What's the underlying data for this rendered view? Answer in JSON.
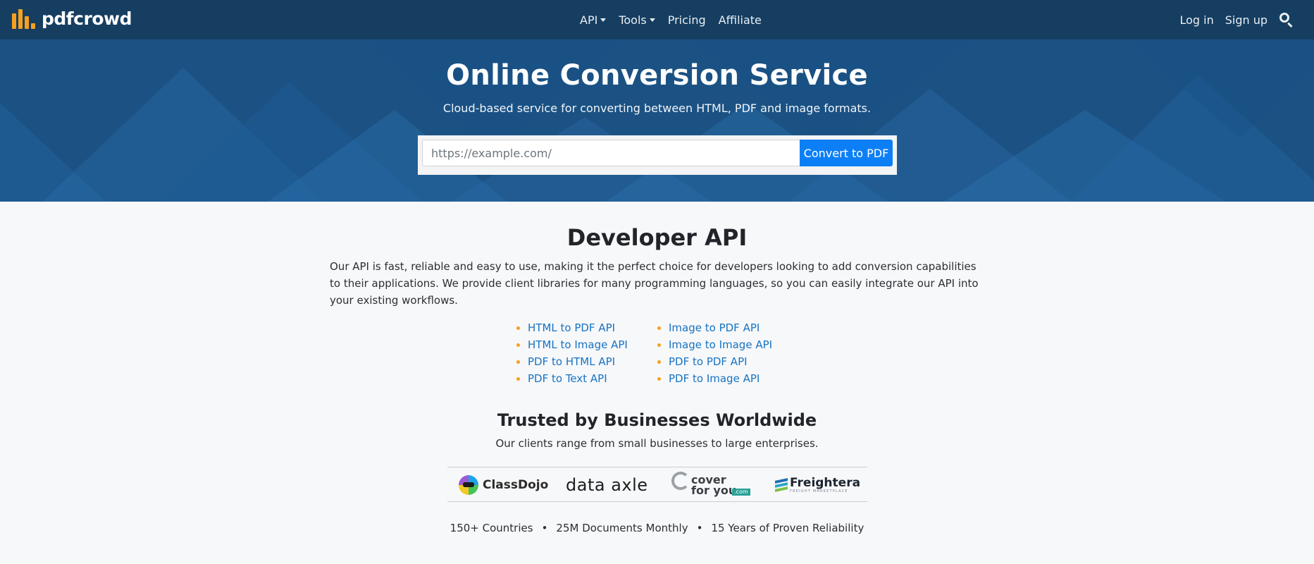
{
  "brand": {
    "name": "pdfcrowd",
    "accent": "#f7a01d"
  },
  "nav": {
    "items": [
      {
        "label": "API",
        "dropdown": true
      },
      {
        "label": "Tools",
        "dropdown": true
      },
      {
        "label": "Pricing",
        "dropdown": false
      },
      {
        "label": "Affiliate",
        "dropdown": false
      }
    ],
    "login": "Log in",
    "signup": "Sign up",
    "search_icon": "search-icon"
  },
  "hero": {
    "title": "Online Conversion Service",
    "subtitle": "Cloud-based service for converting between HTML, PDF and image formats.",
    "url_placeholder": "https://example.com/",
    "url_value": "",
    "convert_label": "Convert to PDF",
    "bg_color": "#1b5283",
    "button_color": "#0d7ff6"
  },
  "developer": {
    "title": "Developer API",
    "description": "Our API is fast, reliable and easy to use, making it the perfect choice for developers looking to add conversion capabilities to their applications. We provide client libraries for many programming languages, so you can easily integrate our API into your existing workflows.",
    "apis_col1": [
      "HTML to PDF API",
      "HTML to Image API",
      "PDF to HTML API",
      "PDF to Text API"
    ],
    "apis_col2": [
      "Image to PDF API",
      "Image to Image API",
      "PDF to PDF API",
      "PDF to Image API"
    ]
  },
  "trusted": {
    "title": "Trusted by Businesses Worldwide",
    "subtitle": "Our clients range from small businesses to large enterprises.",
    "logos": {
      "classdojo": "ClassDojo",
      "dataaxle": "data axle",
      "cover_line1": "cover",
      "cover_line2": "for you",
      "cover_suffix": ".com",
      "freightera": "Freightera",
      "freightera_tag": "FREIGHT MARKETPLACE"
    }
  },
  "stats": {
    "items": [
      "150+ Countries",
      "25M Documents Monthly",
      "15 Years of Proven Reliability"
    ],
    "separator": "•"
  }
}
